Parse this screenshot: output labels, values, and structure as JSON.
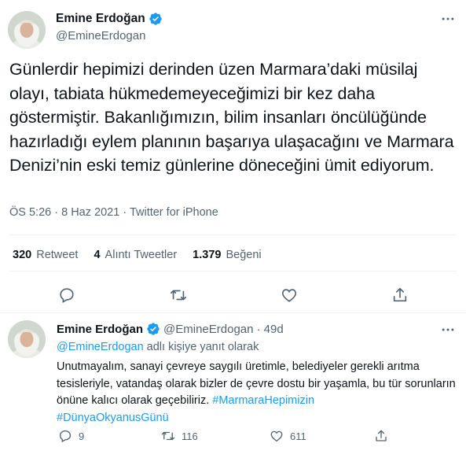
{
  "main_tweet": {
    "author": {
      "name": "Emine Erdoğan",
      "handle": "@EmineErdogan"
    },
    "text": "Günlerdir hepimizi derinden üzen Marmara’daki müsilaj olayı, tabiata hükmedemeyeceğimizi bir kez daha göstermiştir. Bakanlığımızın, bilim insanları öncülüğünde hazırladığı eylem planının başarıya ulaşacağını ve Marmara Denizi’nin eski temiz günlerine döneceğini ümit ediyorum.",
    "time": "ÖS 5:26",
    "separator": "·",
    "date": "8 Haz 2021",
    "source": "Twitter for iPhone",
    "stats": {
      "retweets": {
        "value": "320",
        "label": "Retweet"
      },
      "quotes": {
        "value": "4",
        "label": "Alıntı Tweetler"
      },
      "likes": {
        "value": "1.379",
        "label": "Beğeni"
      }
    }
  },
  "reply": {
    "author": {
      "name": "Emine Erdoğan",
      "handle": "@EmineErdogan",
      "age": "· 49d"
    },
    "replying_to_mention": "@EmineErdogan",
    "replying_to_suffix": " adlı kişiye yanıt olarak",
    "text": "Unutmayalım, sanayi çevreye saygılı üretimle, belediyeler gerekli arıtma tesisleriyle, vatandaş olarak bizler de çevre dostu bir yaşamla, bu tür sorunların önüne kalıcı olarak geçebiliriz.",
    "hashtags": [
      "#MarmaraHepimizin",
      "#DünyaOkyanusGünü"
    ],
    "counts": {
      "replies": "9",
      "retweets": "116",
      "likes": "611"
    }
  },
  "colors": {
    "accent": "#1d9bf0",
    "text_primary": "#0f1419",
    "text_secondary": "#536471",
    "divider": "#eff3f4"
  },
  "icons": [
    "verified-badge-icon",
    "more-icon",
    "reply-icon",
    "retweet-icon",
    "like-icon",
    "share-icon"
  ]
}
